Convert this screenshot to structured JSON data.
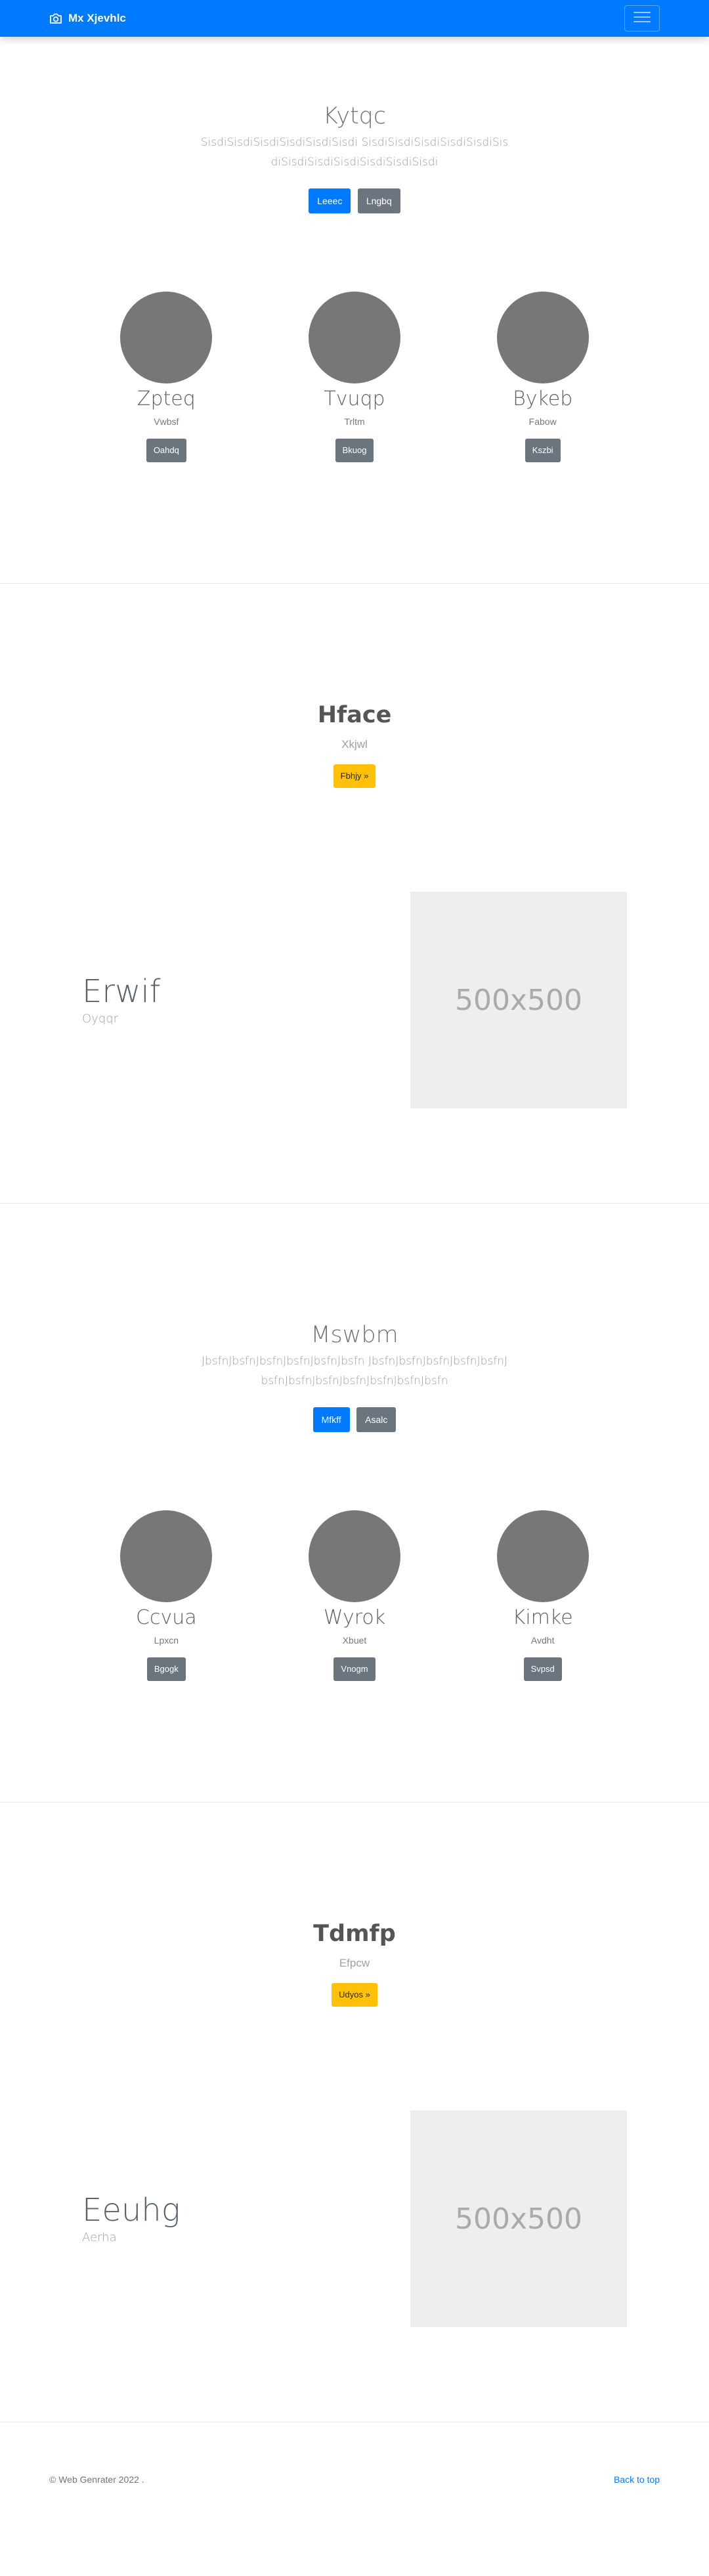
{
  "navbar": {
    "brand": "Mx Xjevhlc",
    "brand_icon": "camera-icon",
    "toggler_icon": "hamburger-icon",
    "bg_color": "#007bff"
  },
  "section1": {
    "title": "Kytqc",
    "lead": "SisdiSisdiSisdiSisdiSisdiSisdi SisdiSisdiSisdiSisdiSisdiSisdiSisdiSisdiSisdiSisdiSisdiSisdi",
    "buttons": [
      "Leeec",
      "Lngbq"
    ],
    "items": [
      {
        "title": "Zpteq",
        "sub": "Vwbsf",
        "button": "Oahdq"
      },
      {
        "title": "Tvuqp",
        "sub": "Trltm",
        "button": "Bkuog"
      },
      {
        "title": "Bykeb",
        "sub": "Fabow",
        "button": "Kszbi"
      }
    ]
  },
  "feature1": {
    "title": "Hface",
    "sub": "Xkjwl",
    "button": "Fbhjy »"
  },
  "split1": {
    "title": "Erwif",
    "sub": "Oyqqr",
    "image_label": "500x500"
  },
  "section2": {
    "title": "Mswbm",
    "lead": "JbsfnJbsfnJbsfnJbsfnJbsfnJbsfn JbsfnJbsfnJbsfnJbsfnJbsfnJbsfnJbsfnJbsfnJbsfnJbsfnJbsfnJbsfn",
    "buttons": [
      "Mfkff",
      "Asalc"
    ],
    "items": [
      {
        "title": "Ccvua",
        "sub": "Lpxcn",
        "button": "Bgogk"
      },
      {
        "title": "Wyrok",
        "sub": "Xbuet",
        "button": "Vnogm"
      },
      {
        "title": "Kimke",
        "sub": "Avdht",
        "button": "Svpsd"
      }
    ]
  },
  "feature2": {
    "title": "Tdmfp",
    "sub": "Efpcw",
    "button": "Udyos »"
  },
  "split2": {
    "title": "Eeuhg",
    "sub": "Aerha",
    "image_label": "500x500"
  },
  "footer": {
    "copyright": "© Web Genrater 2022 .",
    "back_to_top": "Back to top"
  }
}
